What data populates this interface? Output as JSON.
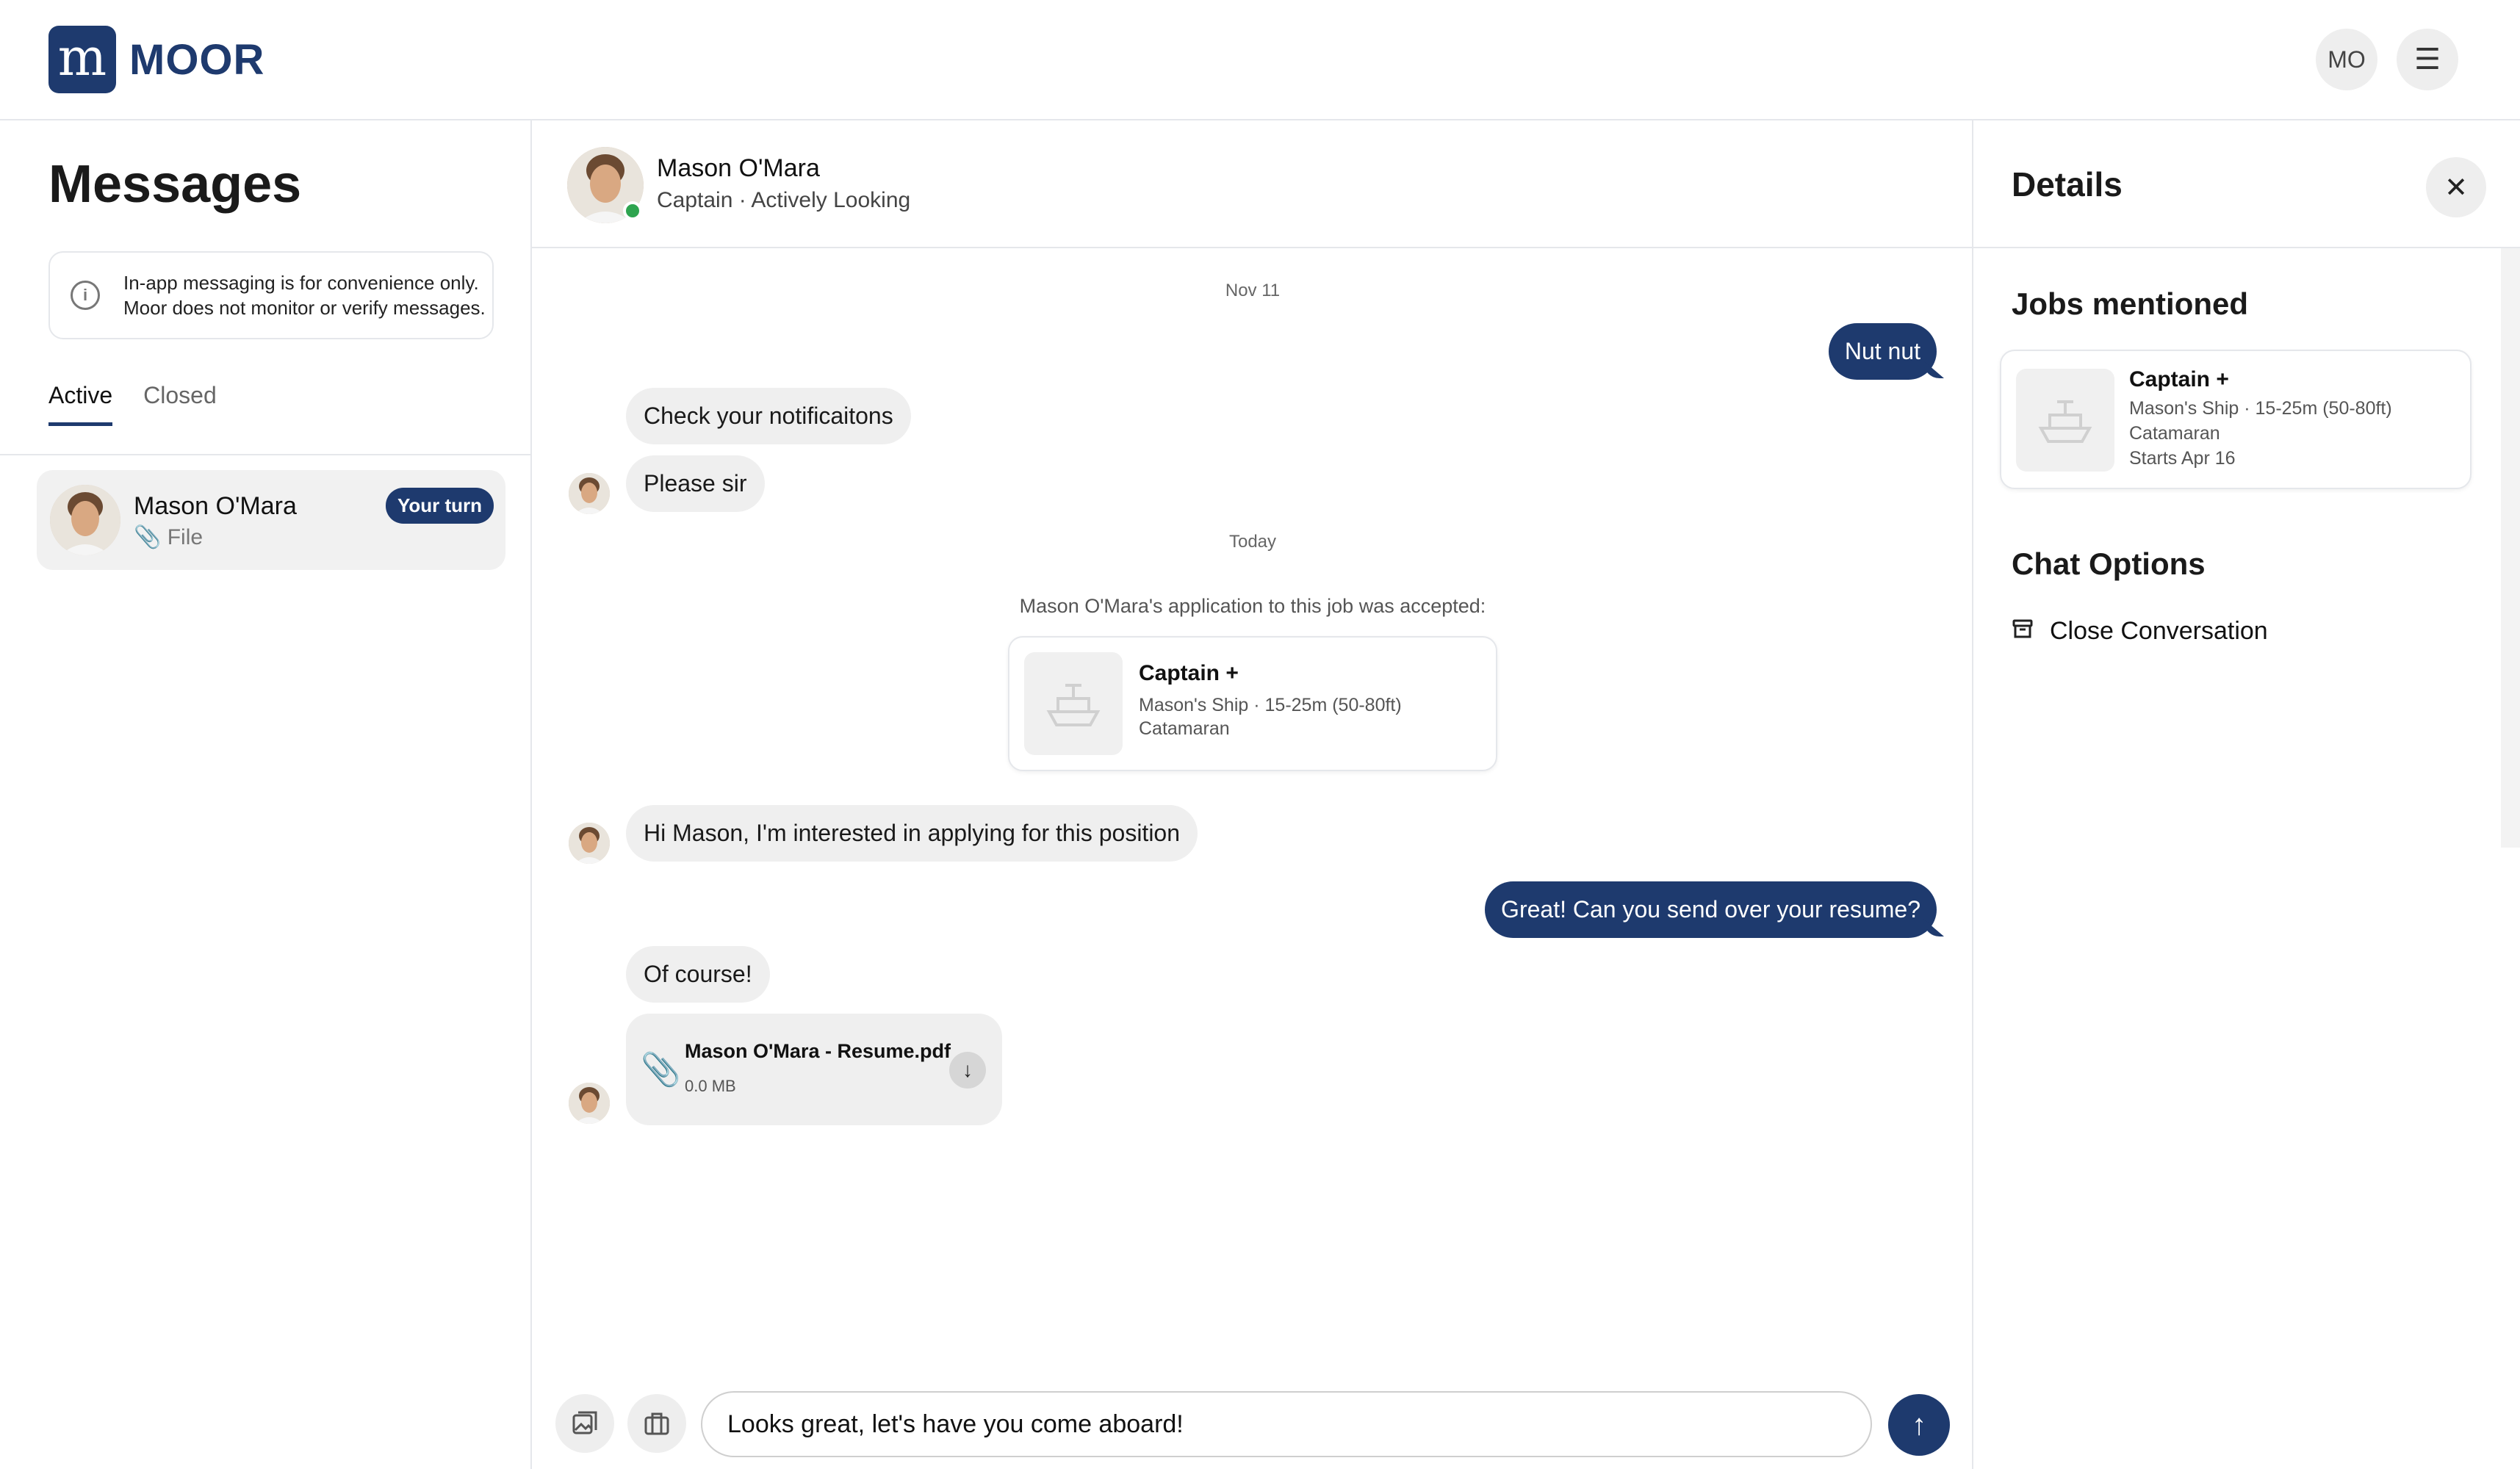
{
  "header": {
    "logo_text": "MOOR",
    "user_initials": "MO"
  },
  "messages_panel": {
    "title": "Messages",
    "notice": "In-app messaging is for convenience only. Moor does not monitor or verify messages.",
    "tabs": [
      {
        "label": "Active",
        "selected": true
      },
      {
        "label": "Closed",
        "selected": false
      }
    ],
    "conversations": [
      {
        "name": "Mason O'Mara",
        "preview": "File",
        "badge": "Your turn"
      }
    ]
  },
  "chat": {
    "contact_name": "Mason O'Mara",
    "contact_role": "Captain · Actively Looking",
    "date_1": "Nov 11",
    "msg_nut": "Nut nut",
    "msg_notifications": "Check your notificaitons",
    "msg_please": "Please sir",
    "date_2": "Today",
    "system_note": "Mason O'Mara's application to this job was accepted:",
    "job_card": {
      "title": "Captain +",
      "details": "Mason's Ship · 15-25m (50-80ft)",
      "type": "Catamaran"
    },
    "msg_interested": "Hi Mason, I'm interested in applying for this position",
    "msg_resume_request": "Great! Can you send over your resume?",
    "msg_of_course": "Of course!",
    "file": {
      "name": "Mason O'Mara - Resume.pdf",
      "size": "0.0 MB"
    },
    "composer_value": "Looks great, let's have you come aboard!"
  },
  "details_panel": {
    "title": "Details",
    "jobs_heading": "Jobs mentioned",
    "job": {
      "title": "Captain +",
      "details": "Mason's Ship · 15-25m (50-80ft)",
      "type": "Catamaran",
      "start": "Starts Apr 16"
    },
    "options_heading": "Chat Options",
    "close_label": "Close Conversation"
  },
  "colors": {
    "brand": "#1e3a6e",
    "online": "#2ea44f",
    "bubble_in": "#efefef"
  }
}
